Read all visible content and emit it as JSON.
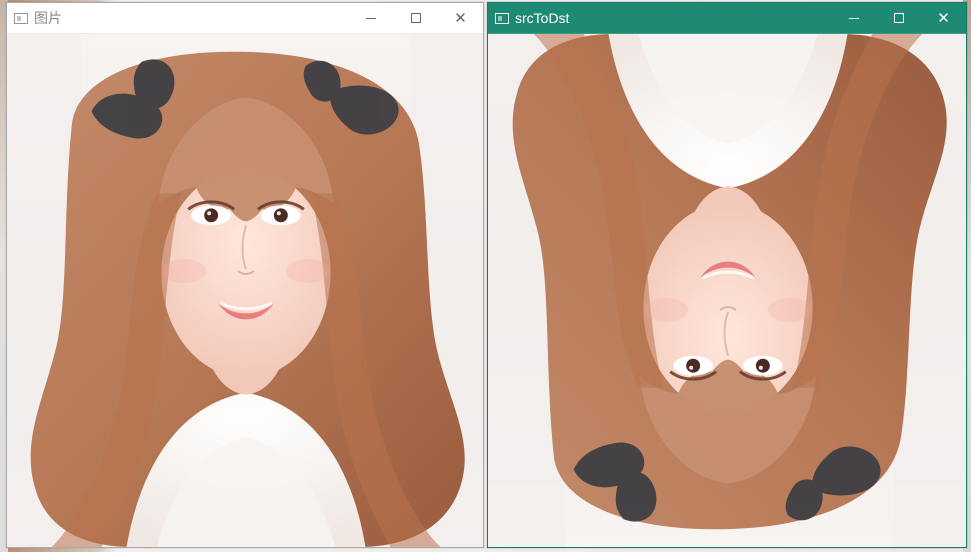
{
  "windows": [
    {
      "title": "图片",
      "icon": "app-window-icon",
      "controls": {
        "minimize_symbol": "—",
        "maximize_symbol": "☐",
        "close_symbol": "✕"
      },
      "image": {
        "description": "",
        "mirror": "none"
      },
      "colors": {
        "titlebar_bg": "#ffffff",
        "titlebar_fg": "#8a8a8a"
      }
    },
    {
      "title": "srcToDst",
      "icon": "app-window-icon",
      "controls": {
        "minimize_symbol": "—",
        "maximize_symbol": "☐",
        "close_symbol": "✕"
      },
      "image": {
        "description": "",
        "mirror": "vertical"
      },
      "colors": {
        "titlebar_bg": "#1f8a73",
        "titlebar_fg": "#ffffff"
      }
    }
  ]
}
